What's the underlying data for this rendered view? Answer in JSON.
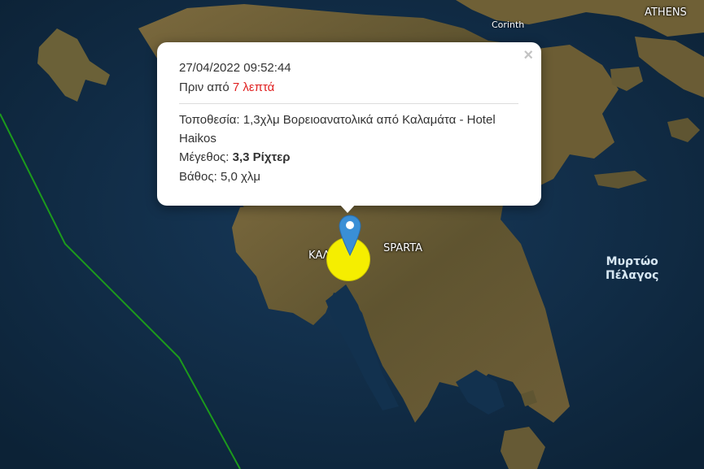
{
  "map": {
    "labels": {
      "athens": "ATHENS",
      "corinth": "Corinth",
      "kalamata": "ΚΑΛΑΜΑΤΑ",
      "sparta": "SPARTA",
      "sea_line1": "Μυρτώο",
      "sea_line2": "Πέλαγος"
    },
    "colors": {
      "sea": "#0f2a3f",
      "land": "#6b5a33",
      "boundary_line": "#1c9a1c",
      "epicenter_circle": "#f5ee00",
      "pin": "#3a8fd6"
    },
    "marker_icon": "map-pin-icon"
  },
  "popup": {
    "close_label": "×",
    "datetime": "27/04/2022 09:52:44",
    "ago_prefix": "Πριν από ",
    "ago_value": "7 λεπτά",
    "location_label": "Τοποθεσία: ",
    "location_value": "1,3χλμ Βορειοανατολικά από Καλαμάτα - Hotel Haikos",
    "magnitude_label": "Μέγεθος: ",
    "magnitude_value": "3,3 Ρίχτερ",
    "depth_label": "Βάθος: ",
    "depth_value": "5,0 χλμ"
  }
}
